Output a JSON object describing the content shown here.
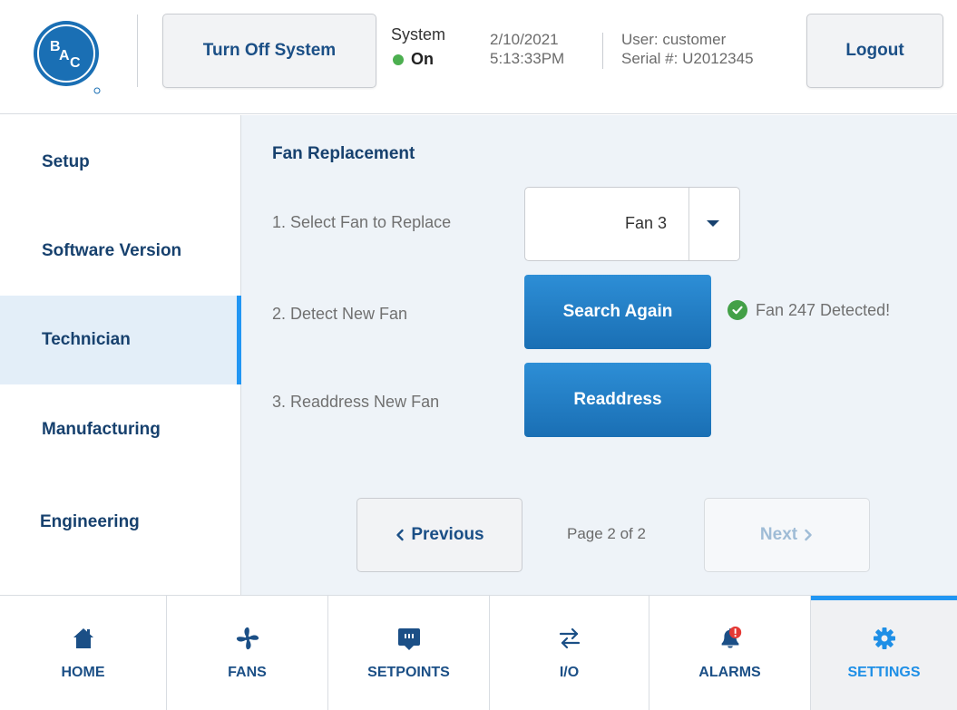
{
  "header": {
    "logo_text": "BAC",
    "turn_off_label": "Turn Off System",
    "system_label": "System",
    "system_state": "On",
    "date": "2/10/2021",
    "time": "5:13:33PM",
    "user": "User: customer",
    "serial": "Serial #: U2012345",
    "logout_label": "Logout"
  },
  "sidebar": {
    "items": [
      {
        "label": "Setup"
      },
      {
        "label": "Software Version"
      },
      {
        "label": "Technician"
      },
      {
        "label": "Manufacturing"
      },
      {
        "label": "Engineering"
      }
    ]
  },
  "main": {
    "title": "Fan Replacement",
    "steps": [
      {
        "label": "1. Select Fan to Replace"
      },
      {
        "label": "2. Detect New Fan"
      },
      {
        "label": "3. Readdress New Fan"
      }
    ],
    "fan_select_value": "Fan 3",
    "search_again_label": "Search Again",
    "detected_text": "Fan 247 Detected!",
    "readdress_label": "Readdress",
    "previous_label": "Previous",
    "next_label": "Next",
    "page_info": "Page 2 of 2"
  },
  "nav": {
    "items": [
      {
        "label": "HOME",
        "icon": "home-icon"
      },
      {
        "label": "FANS",
        "icon": "fan-icon"
      },
      {
        "label": "SETPOINTS",
        "icon": "setpoints-icon"
      },
      {
        "label": "I/O",
        "icon": "io-arrows-icon"
      },
      {
        "label": "ALARMS",
        "icon": "alarm-bell-icon"
      },
      {
        "label": "SETTINGS",
        "icon": "gear-icon"
      }
    ]
  },
  "colors": {
    "primary_blue": "#1a6fb4",
    "accent_blue": "#2196f3",
    "dark_text": "#17416e",
    "status_green": "#4caf50",
    "alarm_red": "#e53935"
  }
}
